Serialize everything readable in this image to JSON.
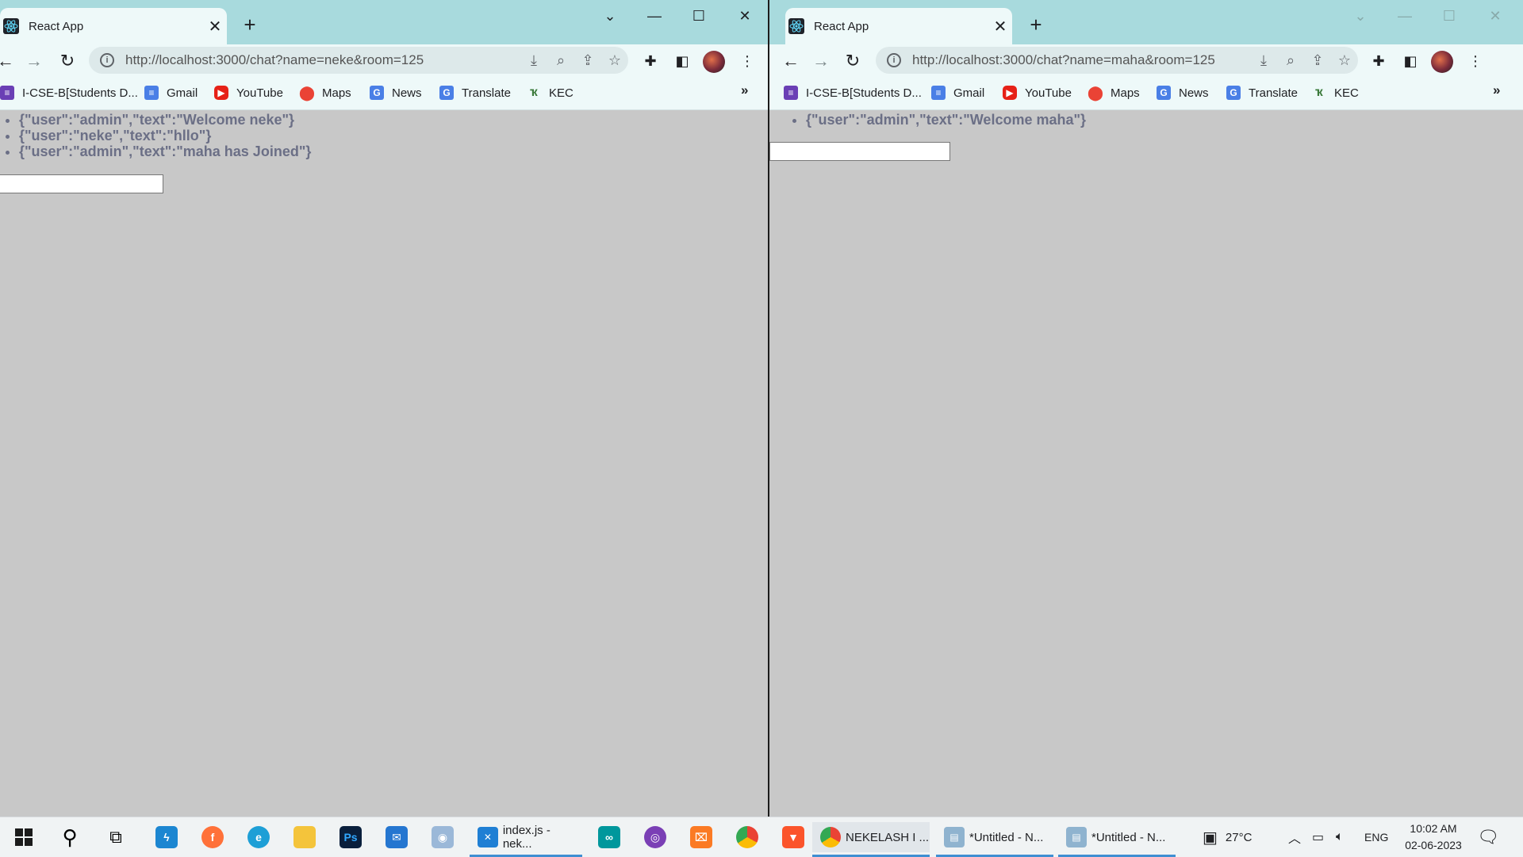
{
  "left_window": {
    "tab_title": "React App",
    "url": "http://localhost:3000/chat?name=neke&room=125",
    "messages": [
      "{\"user\":\"admin\",\"text\":\"Welcome neke\"}",
      "{\"user\":\"neke\",\"text\":\"hllo\"}",
      "{\"user\":\"admin\",\"text\":\"maha has Joined\"}"
    ],
    "input_value": ""
  },
  "right_window": {
    "tab_title": "React App",
    "url": "http://localhost:3000/chat?name=maha&room=125",
    "messages": [
      "{\"user\":\"admin\",\"text\":\"Welcome maha\"}"
    ],
    "input_value": ""
  },
  "bookmarks": [
    {
      "label": "I-CSE-B[Students D...",
      "icon": "forms-icon",
      "color": "#6a3fb5"
    },
    {
      "label": "Gmail",
      "icon": "docs-icon",
      "color": "#4a7fe6"
    },
    {
      "label": "YouTube",
      "icon": "youtube-icon",
      "color": "#e62117"
    },
    {
      "label": "Maps",
      "icon": "maps-pin-icon",
      "color": "#34a853"
    },
    {
      "label": "News",
      "icon": "google-news-icon",
      "color": "#4a7fe6"
    },
    {
      "label": "Translate",
      "icon": "translate-icon",
      "color": "#4a7fe6"
    },
    {
      "label": "KEC",
      "icon": "kec-icon",
      "color": "#3b7a3b"
    }
  ],
  "bookmarks_overflow": "»",
  "taskbar": {
    "apps": [
      {
        "label": "index.js - nek...",
        "icon": "vscode-icon"
      },
      {
        "label": "NEKELASH I ...",
        "icon": "chrome-icon"
      },
      {
        "label": "*Untitled - N...",
        "icon": "notepad-icon"
      },
      {
        "label": "*Untitled - N...",
        "icon": "notepad-icon"
      }
    ],
    "weather": "27°C",
    "language": "ENG",
    "time": "10:02 AM",
    "date": "02-06-2023"
  },
  "colors": {
    "tabstrip": "#a8dadd",
    "toolbar": "#eef9f9",
    "page_bg": "#c8c8c8",
    "message_text": "#6b6f86"
  }
}
